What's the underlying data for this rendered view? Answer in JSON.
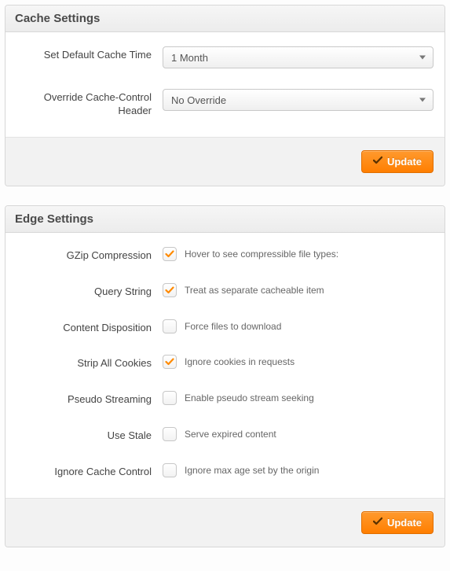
{
  "cache": {
    "title": "Cache Settings",
    "default_time_label": "Set Default Cache Time",
    "default_time_value": "1 Month",
    "override_label": "Override Cache-Control Header",
    "override_value": "No Override",
    "update_label": "Update"
  },
  "edge": {
    "title": "Edge Settings",
    "items": [
      {
        "label": "GZip Compression",
        "checked": true,
        "desc": "Hover to see compressible file types:"
      },
      {
        "label": "Query String",
        "checked": true,
        "desc": "Treat as separate cacheable item"
      },
      {
        "label": "Content Disposition",
        "checked": false,
        "desc": "Force files to download"
      },
      {
        "label": "Strip All Cookies",
        "checked": true,
        "desc": "Ignore cookies in requests"
      },
      {
        "label": "Pseudo Streaming",
        "checked": false,
        "desc": "Enable pseudo stream seeking"
      },
      {
        "label": "Use Stale",
        "checked": false,
        "desc": "Serve expired content"
      },
      {
        "label": "Ignore Cache Control",
        "checked": false,
        "desc": "Ignore max age set by the origin"
      }
    ],
    "update_label": "Update"
  }
}
